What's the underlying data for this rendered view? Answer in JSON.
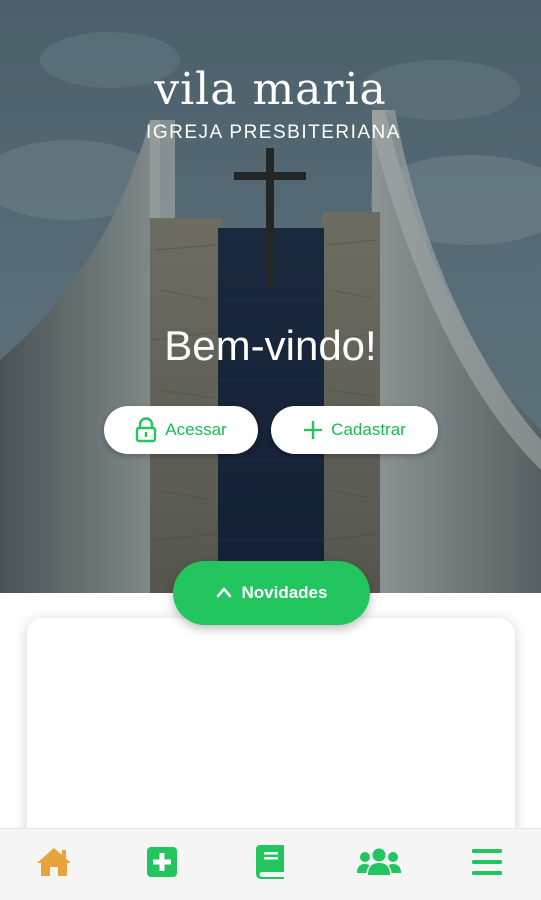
{
  "header": {
    "title": "vila maria",
    "subtitle": "IGREJA PRESBITERIANA"
  },
  "hero": {
    "welcome": "Bem-vindo!",
    "login_label": "Acessar",
    "signup_label": "Cadastrar"
  },
  "news": {
    "label": "Novidades"
  },
  "bottom_nav": {
    "items": [
      {
        "icon": "home-icon",
        "color": "#e8a33d"
      },
      {
        "icon": "plus-square-icon",
        "color": "#22c55e"
      },
      {
        "icon": "book-icon",
        "color": "#22c55e"
      },
      {
        "icon": "users-icon",
        "color": "#22c55e"
      },
      {
        "icon": "menu-icon",
        "color": "#22c55e"
      }
    ]
  },
  "colors": {
    "accent": "#22c55e",
    "home_active": "#e8a33d",
    "background": "#ffffff"
  }
}
